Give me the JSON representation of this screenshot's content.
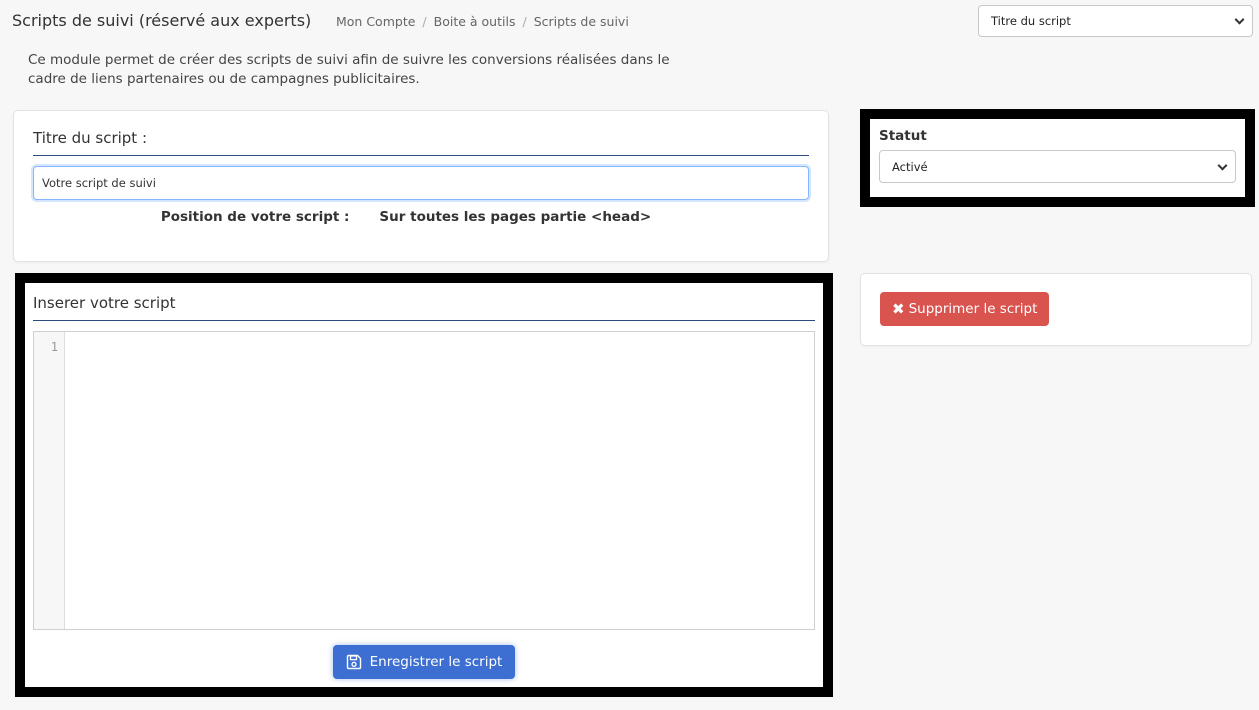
{
  "header": {
    "title": "Scripts de suivi (réservé aux experts)",
    "breadcrumb": [
      "Mon Compte",
      "Boite à outils",
      "Scripts de suivi"
    ]
  },
  "script_selector": {
    "selected": "Titre du script"
  },
  "intro": "Ce module permet de créer des scripts de suivi afin de suivre les conversions réalisées dans le cadre de liens partenaires ou de campagnes publicitaires.",
  "title_card": {
    "label": "Titre du script :",
    "input_value": "Votre script de suivi",
    "position_label": "Position de votre script :",
    "position_value": "Sur toutes les pages partie <head>"
  },
  "statut": {
    "label": "Statut",
    "selected": "Activé"
  },
  "script_card": {
    "label": "Inserer votre script",
    "line_number": "1",
    "save_label": "Enregistrer le script"
  },
  "delete": {
    "label": "Supprimer le script"
  },
  "colors": {
    "accent": "#3c6fd1",
    "danger": "#d9534f",
    "title_rule": "#2a4b7c"
  },
  "icons": {
    "save": "floppy-disk-icon",
    "delete": "times-icon",
    "dropdown": "chevron-down-icon"
  }
}
